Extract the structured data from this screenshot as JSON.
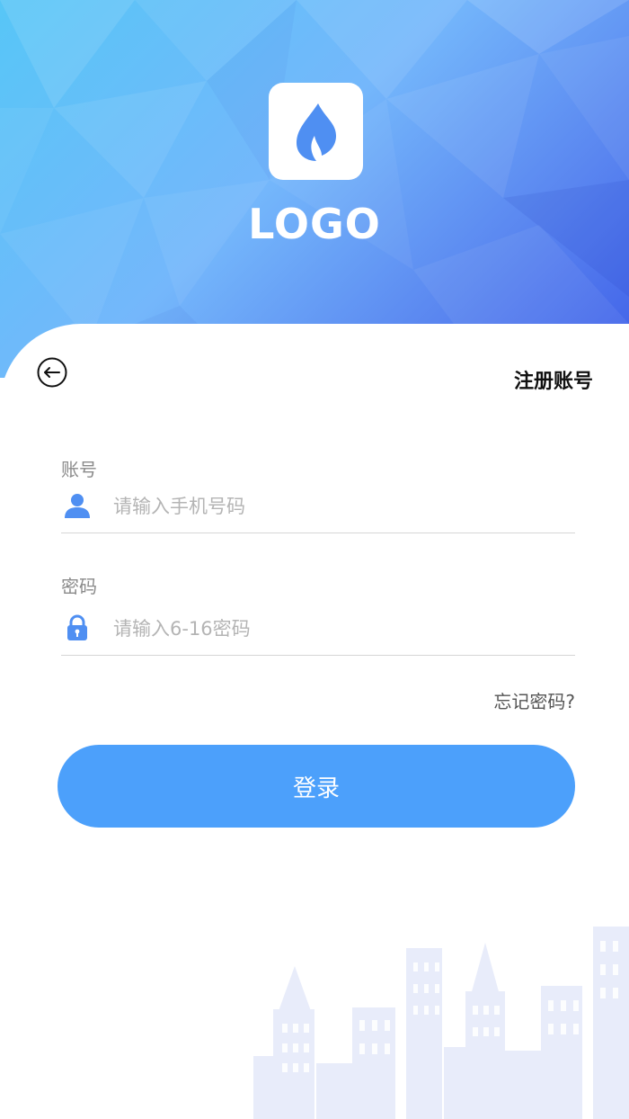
{
  "brand": {
    "logo_text": "LOGO",
    "icon": "flame-icon"
  },
  "header": {
    "back_icon": "back-arrow-icon",
    "register_label": "注册账号"
  },
  "form": {
    "account": {
      "label": "账号",
      "placeholder": "请输入手机号码",
      "icon": "user-icon"
    },
    "password": {
      "label": "密码",
      "placeholder": "请输入6-16密码",
      "icon": "lock-icon"
    },
    "forgot_label": "忘记密码?",
    "login_label": "登录"
  },
  "colors": {
    "accent": "#4ca0fb",
    "gradient_start": "#57c6f7",
    "gradient_end": "#3f5fe8"
  }
}
